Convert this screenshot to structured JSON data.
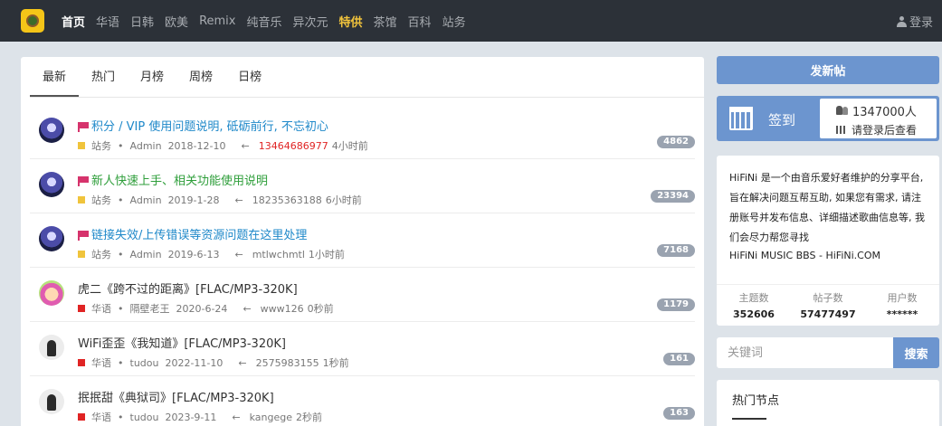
{
  "nav": {
    "items": [
      {
        "label": "首页",
        "style": "active"
      },
      {
        "label": "华语",
        "style": ""
      },
      {
        "label": "日韩",
        "style": ""
      },
      {
        "label": "欧美",
        "style": ""
      },
      {
        "label": "Remix",
        "style": ""
      },
      {
        "label": "纯音乐",
        "style": ""
      },
      {
        "label": "异次元",
        "style": ""
      },
      {
        "label": "特供",
        "style": "featured"
      },
      {
        "label": "茶馆",
        "style": ""
      },
      {
        "label": "百科",
        "style": ""
      },
      {
        "label": "站务",
        "style": ""
      }
    ],
    "login": "登录"
  },
  "tabs": [
    "最新",
    "热门",
    "月榜",
    "周榜",
    "日榜"
  ],
  "threads": [
    {
      "title": "积分 / VIP 使用问题说明, 砥砺前行, 不忘初心",
      "pinned": true,
      "title_color": "blue",
      "forum": "站务",
      "forum_color": "yellow",
      "author": "Admin",
      "date": "2018-12-10",
      "arrow": "←",
      "last_user": "13464686977",
      "last_user_red": true,
      "time": "4小时前",
      "replies": "4862",
      "avatar": "admin"
    },
    {
      "title": "新人快速上手、相关功能使用说明",
      "pinned": true,
      "title_color": "green",
      "forum": "站务",
      "forum_color": "yellow",
      "author": "Admin",
      "date": "2019-1-28",
      "arrow": "←",
      "last_user": "18235363188",
      "last_user_red": false,
      "time": "6小时前",
      "replies": "23394",
      "avatar": "admin"
    },
    {
      "title": "链接失效/上传错误等资源问题在这里处理",
      "pinned": true,
      "title_color": "blue",
      "forum": "站务",
      "forum_color": "yellow",
      "author": "Admin",
      "date": "2019-6-13",
      "arrow": "←",
      "last_user": "mtlwchmtl",
      "last_user_red": false,
      "time": "1小时前",
      "replies": "7168",
      "avatar": "admin"
    },
    {
      "title": "虎二《跨不过的距离》[FLAC/MP3-320K]",
      "pinned": false,
      "title_color": "dark",
      "forum": "华语",
      "forum_color": "red",
      "author": "隔壁老王",
      "date": "2020-6-24",
      "arrow": "←",
      "last_user": "www126",
      "last_user_red": false,
      "time": "0秒前",
      "replies": "1179",
      "avatar": "anime"
    },
    {
      "title": "WiFi歪歪《我知道》[FLAC/MP3-320K]",
      "pinned": false,
      "title_color": "dark",
      "forum": "华语",
      "forum_color": "red",
      "author": "tudou",
      "date": "2022-11-10",
      "arrow": "←",
      "last_user": "2575983155",
      "last_user_red": false,
      "time": "1秒前",
      "replies": "161",
      "avatar": "default"
    },
    {
      "title": "抿抿甜《典狱司》[FLAC/MP3-320K]",
      "pinned": false,
      "title_color": "dark",
      "forum": "华语",
      "forum_color": "red",
      "author": "tudou",
      "date": "2023-9-11",
      "arrow": "←",
      "last_user": "kangege",
      "last_user_red": false,
      "time": "2秒前",
      "replies": "163",
      "avatar": "default"
    }
  ],
  "sidebar": {
    "post_button": "发新帖",
    "checkin_label": "签到",
    "user_count": "1347000人",
    "login_to_view": "请登录后查看",
    "about": "HiFiNi 是一个由音乐爱好者维护的分享平台, 旨在解决问题互帮互助, 如果您有需求, 请注册账号并发布信息、详细描述歌曲信息等, 我们会尽力帮您寻找",
    "about_footer": "HiFiNi MUSIC BBS - HiFiNi.COM",
    "stats": [
      {
        "label": "主题数",
        "value": "352606"
      },
      {
        "label": "帖子数",
        "value": "57477497"
      },
      {
        "label": "用户数",
        "value": "******"
      }
    ],
    "search_placeholder": "关键词",
    "search_button": "搜索",
    "hot_nodes_title": "热门节点"
  },
  "colors": {
    "navbar": "#2c3138",
    "accent": "#6c95cf",
    "featured": "#f2c43c",
    "pin": "#d6336c"
  }
}
